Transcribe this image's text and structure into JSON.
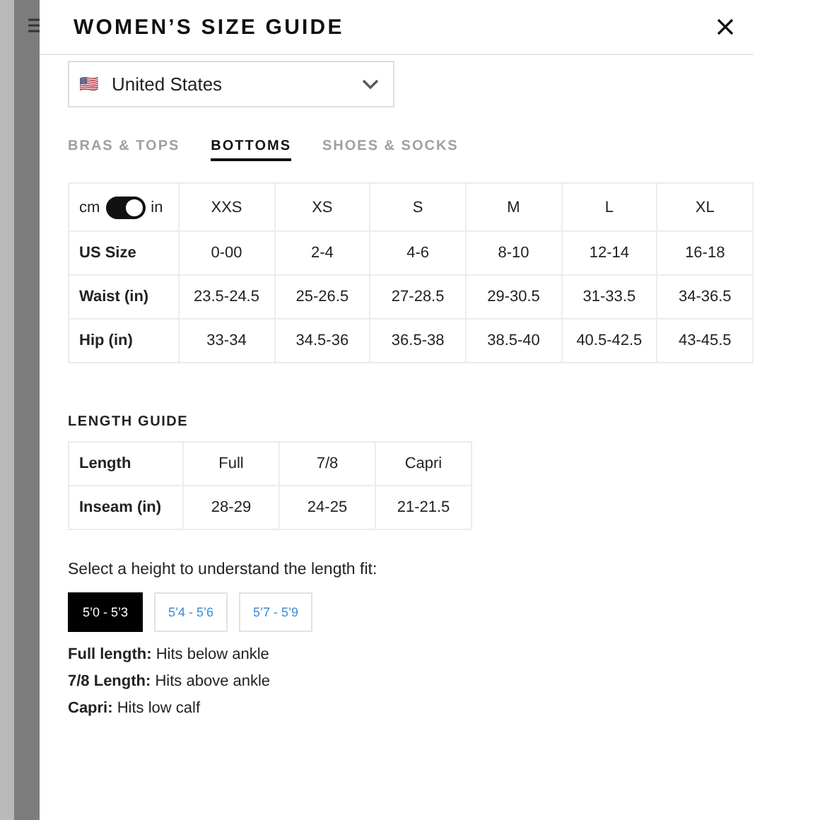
{
  "title": "WOMEN’S SIZE GUIDE",
  "country": {
    "flag": "🇺🇸",
    "value": "United States"
  },
  "tabs": [
    {
      "label": "BRAS & TOPS",
      "selected": false
    },
    {
      "label": "BOTTOMS",
      "selected": true
    },
    {
      "label": "SHOES & SOCKS",
      "selected": false
    }
  ],
  "unit_toggle": {
    "left": "cm",
    "right": "in",
    "on": true
  },
  "size_table": {
    "columns": [
      "XXS",
      "XS",
      "S",
      "M",
      "L",
      "XL"
    ],
    "rows": [
      {
        "label": "US Size",
        "cells": [
          "0-00",
          "2-4",
          "4-6",
          "8-10",
          "12-14",
          "16-18"
        ]
      },
      {
        "label": "Waist (in)",
        "cells": [
          "23.5-24.5",
          "25-26.5",
          "27-28.5",
          "29-30.5",
          "31-33.5",
          "34-36.5"
        ]
      },
      {
        "label": "Hip (in)",
        "cells": [
          "33-34",
          "34.5-36",
          "36.5-38",
          "38.5-40",
          "40.5-42.5",
          "43-45.5"
        ]
      }
    ]
  },
  "length_guide": {
    "title": "LENGTH GUIDE",
    "rows": [
      {
        "label": "Length",
        "cells": [
          "Full",
          "7/8",
          "Capri"
        ]
      },
      {
        "label": "Inseam (in)",
        "cells": [
          "28-29",
          "24-25",
          "21-21.5"
        ]
      }
    ]
  },
  "height_prompt": "Select a height to understand the length fit:",
  "heights": [
    {
      "label": "5’0 - 5’3",
      "selected": true
    },
    {
      "label": "5’4 - 5’6",
      "selected": false
    },
    {
      "label": "5’7 - 5’9",
      "selected": false
    }
  ],
  "fit_notes": [
    "**Full length:** Hits below ankle",
    "**7/8 Length:** Hits above ankle",
    "**Capri:** Hits low calf"
  ]
}
